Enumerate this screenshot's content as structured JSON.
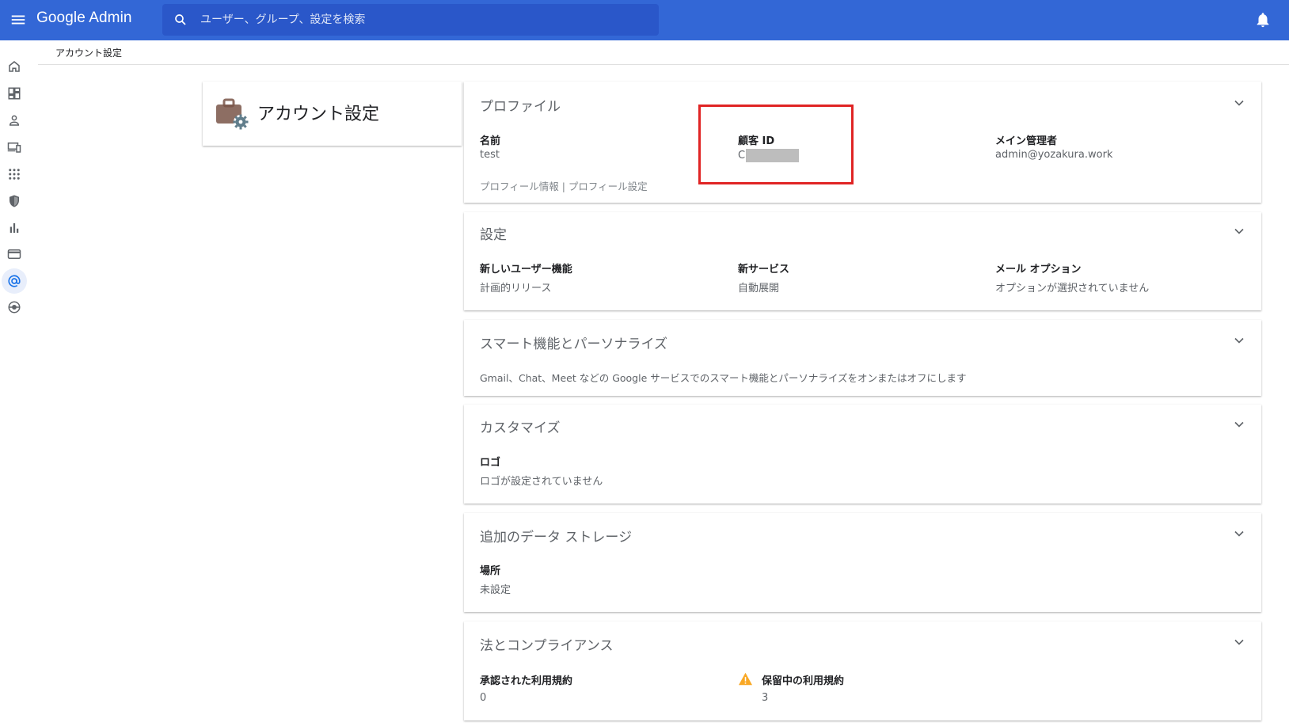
{
  "app": {
    "brand": "Google Admin"
  },
  "search": {
    "placeholder": "ユーザー、グループ、設定を検索"
  },
  "rail": {
    "items": [
      {
        "icon": "home-icon"
      },
      {
        "icon": "dashboard-icon"
      },
      {
        "icon": "person-icon"
      },
      {
        "icon": "devices-icon"
      },
      {
        "icon": "apps-icon"
      },
      {
        "icon": "security-icon"
      },
      {
        "icon": "reports-icon"
      },
      {
        "icon": "billing-icon"
      },
      {
        "icon": "account-icon"
      },
      {
        "icon": "rules-icon"
      }
    ],
    "active": "account-icon"
  },
  "breadcrumb": "アカウント設定",
  "title_card": {
    "title": "アカウント設定"
  },
  "sections": {
    "profile": {
      "title": "プロファイル",
      "name_label": "名前",
      "name_value": "test",
      "customer_id_label": "顧客 ID",
      "customer_id_value": "C",
      "admin_label": "メイン管理者",
      "admin_value": "admin@yozakura.work",
      "links": "プロフィール情報 | プロフィール設定"
    },
    "settings": {
      "title": "設定",
      "new_user_label": "新しいユーザー機能",
      "new_user_value": "計画的リリース",
      "new_service_label": "新サービス",
      "new_service_value": "自動展開",
      "mail_label": "メール オプション",
      "mail_value": "オプションが選択されていません"
    },
    "smart": {
      "title": "スマート機能とパーソナライズ",
      "description": "Gmail、Chat、Meet などの Google サービスでのスマート機能とパーソナライズをオンまたはオフにします"
    },
    "customize": {
      "title": "カスタマイズ",
      "logo_label": "ロゴ",
      "logo_value": "ロゴが設定されていません"
    },
    "storage": {
      "title": "追加のデータ ストレージ",
      "location_label": "場所",
      "location_value": "未設定"
    },
    "legal": {
      "title": "法とコンプライアンス",
      "accepted_label": "承認された利用規約",
      "accepted_value": "0",
      "pending_label": "保留中の利用規約",
      "pending_value": "3"
    }
  },
  "colors": {
    "topbar": "#3367d6",
    "highlight": "#e02424",
    "warning": "#f9a825"
  }
}
